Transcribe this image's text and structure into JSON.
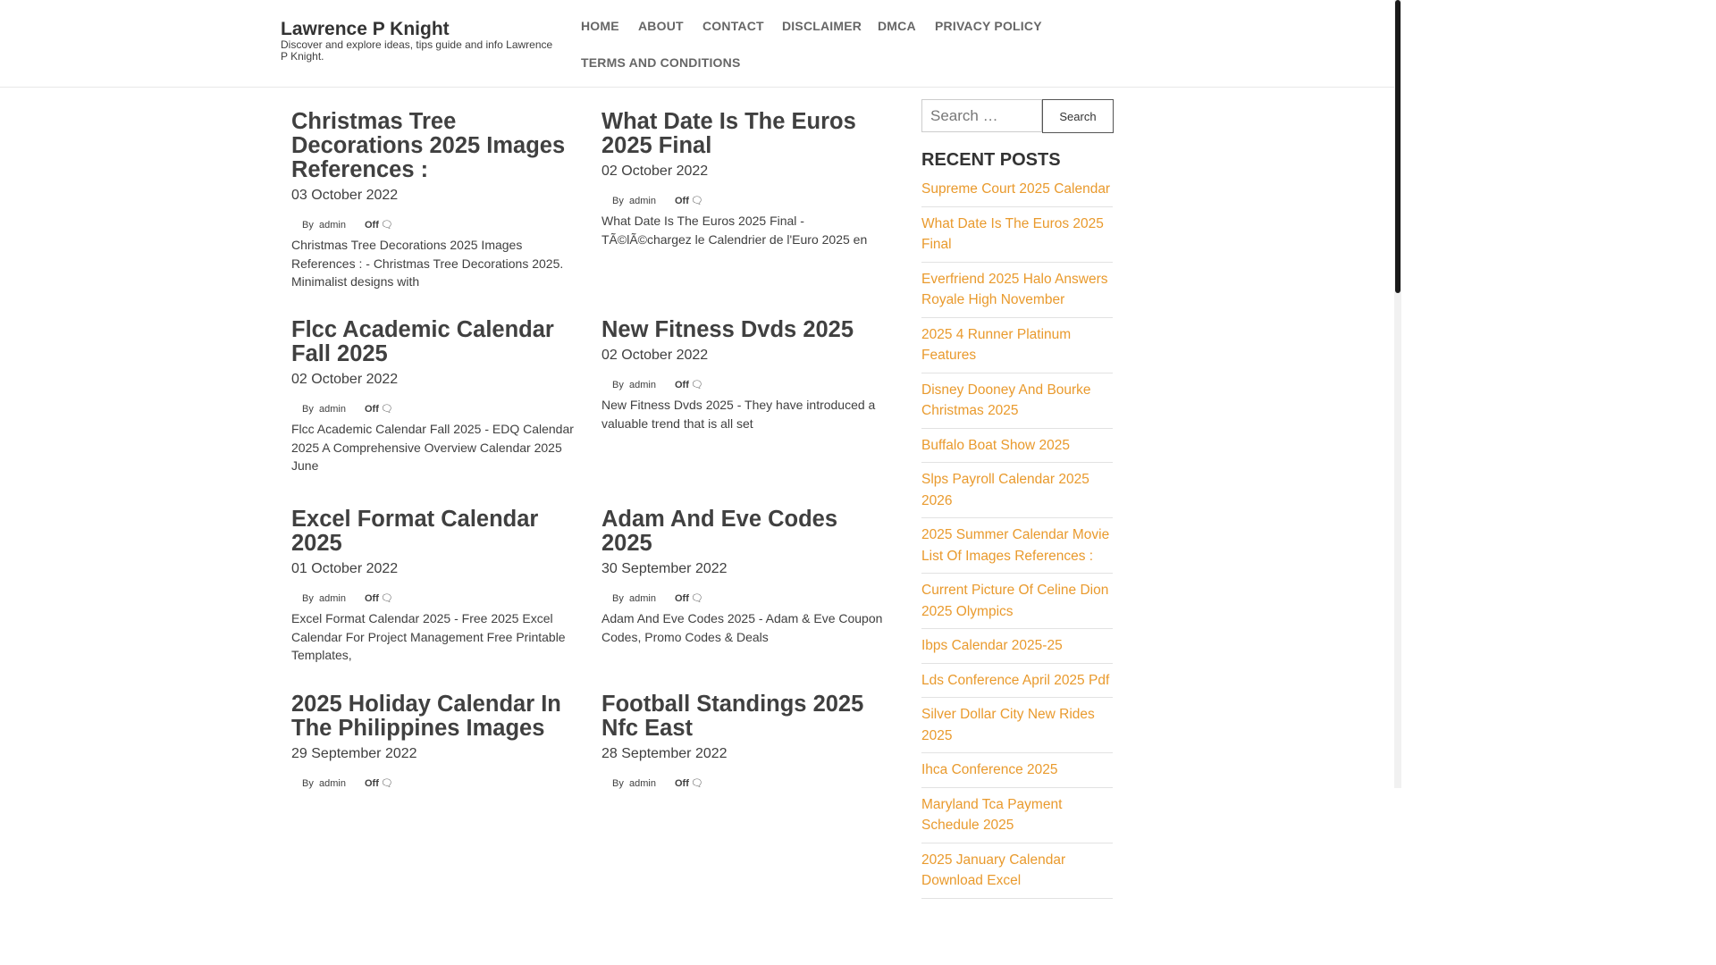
{
  "site": {
    "title": "Lawrence P Knight",
    "description": "Discover and explore ideas, tips guide and info Lawrence P Knight."
  },
  "nav": {
    "items": [
      "HOME",
      "ABOUT",
      "CONTACT",
      "DISCLAIMER",
      "DMCA",
      "PRIVACY POLICY",
      "TERMS AND CONDITIONS"
    ]
  },
  "posts": [
    {
      "title": "Christmas Tree Decorations 2025 Images References :",
      "date": "03 October 2022",
      "by": "By",
      "author": "admin",
      "comments": "Off",
      "comment_icon": "comment-icon",
      "excerpt": "Christmas Tree Decorations 2025 Images References : - Christmas Tree Decorations 2025. Minimalist designs with"
    },
    {
      "title": "What Date Is The Euros 2025 Final",
      "date": "02 October 2022",
      "by": "By",
      "author": "admin",
      "comments": "Off",
      "comment_icon": "comment-icon",
      "excerpt": "What Date Is The Euros 2025 Final - TÃ©lÃ©chargez le Calendrier de l'Euro 2025 en"
    },
    {
      "title": "Flcc Academic Calendar Fall 2025",
      "date": "02 October 2022",
      "by": "By",
      "author": "admin",
      "comments": "Off",
      "comment_icon": "comment-icon",
      "excerpt": "Flcc Academic Calendar Fall 2025 - EDQ Calendar 2025 A Comprehensive Overview Calendar 2025 June"
    },
    {
      "title": "New Fitness Dvds 2025",
      "date": "02 October 2022",
      "by": "By",
      "author": "admin",
      "comments": "Off",
      "comment_icon": "comment-icon",
      "excerpt": "New Fitness Dvds 2025 - They have introduced a valuable trend that is all set"
    },
    {
      "title": "Excel Format Calendar 2025",
      "date": "01 October 2022",
      "by": "By",
      "author": "admin",
      "comments": "Off",
      "comment_icon": "comment-icon",
      "excerpt": "Excel Format Calendar 2025 - Free 2025 Excel Calendar For Project Management Free Printable Templates,"
    },
    {
      "title": "Adam And Eve Codes 2025",
      "date": "30 September 2022",
      "by": "By",
      "author": "admin",
      "comments": "Off",
      "comment_icon": "comment-icon",
      "excerpt": "Adam And Eve Codes 2025 - Adam & Eve Coupon Codes, Promo Codes & Deals"
    },
    {
      "title": "2025 Holiday Calendar In The Philippines Images",
      "date": "29 September 2022",
      "by": "By",
      "author": "admin",
      "comments": "Off",
      "comment_icon": "comment-icon",
      "excerpt": ""
    },
    {
      "title": "Football Standings 2025 Nfc East",
      "date": "28 September 2022",
      "by": "By",
      "author": "admin",
      "comments": "Off",
      "comment_icon": "comment-icon",
      "excerpt": ""
    }
  ],
  "sidebar": {
    "search_placeholder": "Search …",
    "search_button": "Search",
    "recent_title": "RECENT POSTS",
    "recent_posts": [
      "Supreme Court 2025 Calendar",
      "What Date Is The Euros 2025 Final",
      "Everfriend 2025 Halo Answers Royale High November",
      "2025 4 Runner Platinum Features",
      "Disney Dooney And Bourke Christmas 2025",
      "Buffalo Boat Show 2025",
      "Slps Payroll Calendar 2025 2026",
      "2025 Summer Calendar Movie List Of Images References :",
      "Current Picture Of Celine Dion 2025 Olympics",
      "Ibps Calendar 2025-25",
      "Lds Conference April 2025 Pdf",
      "Silver Dollar City New Rides 2025",
      "Ihca Conference 2025",
      "Maryland Tca Payment Schedule 2025",
      "2025 January Calendar Download Excel"
    ]
  },
  "colors": {
    "link_accent": "#e99a2d",
    "text": "#404040",
    "nav_text": "#666666"
  }
}
